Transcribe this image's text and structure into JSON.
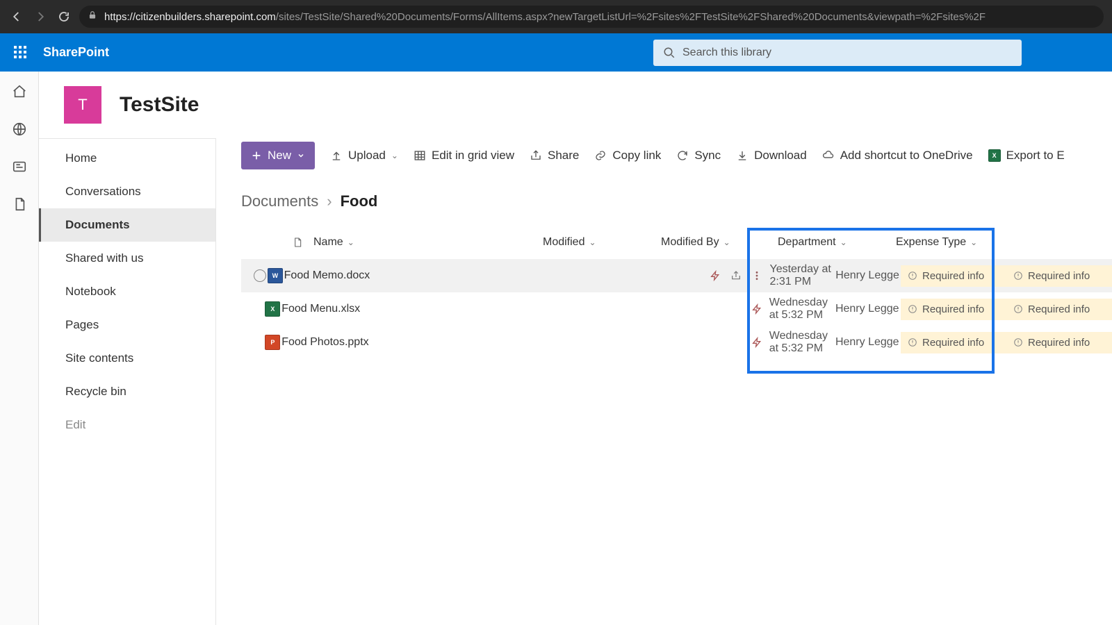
{
  "browser": {
    "url_host": "https://citizenbuilders.sharepoint.com",
    "url_path": "/sites/TestSite/Shared%20Documents/Forms/AllItems.aspx?newTargetListUrl=%2Fsites%2FTestSite%2FShared%20Documents&viewpath=%2Fsites%2F"
  },
  "suite": {
    "name": "SharePoint",
    "search_placeholder": "Search this library"
  },
  "site": {
    "logo_letter": "T",
    "title": "TestSite"
  },
  "nav": {
    "items": [
      "Home",
      "Conversations",
      "Documents",
      "Shared with us",
      "Notebook",
      "Pages",
      "Site contents",
      "Recycle bin"
    ],
    "active": "Documents",
    "edit": "Edit"
  },
  "commands": {
    "new": "New",
    "upload": "Upload",
    "edit_grid": "Edit in grid view",
    "share": "Share",
    "copy_link": "Copy link",
    "sync": "Sync",
    "download": "Download",
    "add_shortcut": "Add shortcut to OneDrive",
    "export": "Export to E"
  },
  "breadcrumb": {
    "parent": "Documents",
    "current": "Food"
  },
  "columns": {
    "name": "Name",
    "modified": "Modified",
    "modified_by": "Modified By",
    "department": "Department",
    "expense_type": "Expense Type"
  },
  "required_label": "Required info",
  "files": [
    {
      "type": "W",
      "name": "Food Memo.docx",
      "modified": "Yesterday at 2:31 PM",
      "by": "Henry Legge",
      "hover": true
    },
    {
      "type": "X",
      "name": "Food Menu.xlsx",
      "modified": "Wednesday at 5:32 PM",
      "by": "Henry Legge",
      "hover": false
    },
    {
      "type": "P",
      "name": "Food Photos.pptx",
      "modified": "Wednesday at 5:32 PM",
      "by": "Henry Legge",
      "hover": false
    }
  ]
}
